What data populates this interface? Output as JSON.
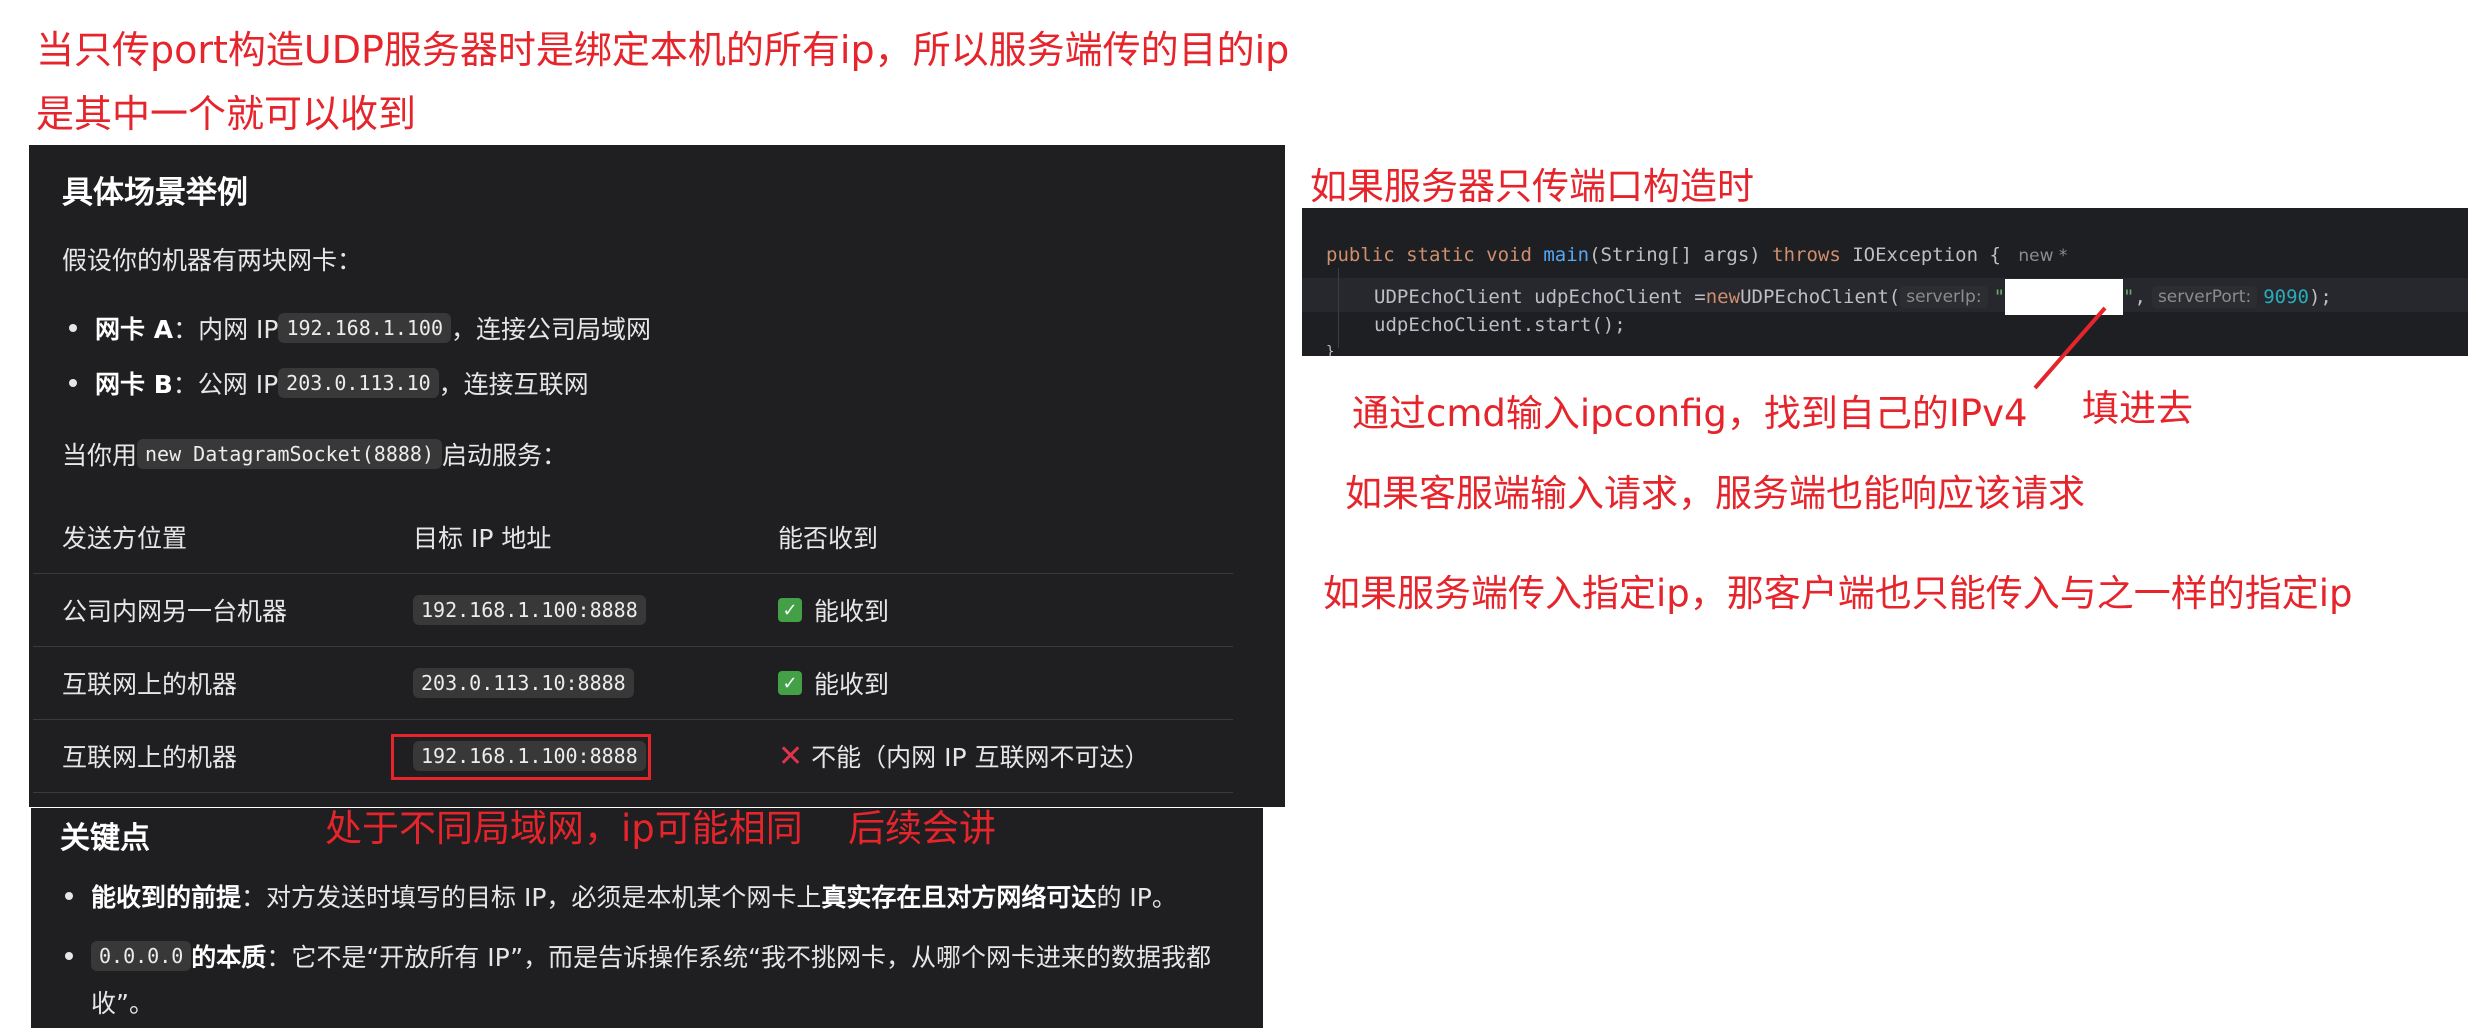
{
  "annotations": {
    "heading_note": "当只传port构造UDP服务器时是绑定本机的所有ip，所以服务端传的目的ip是其中一个就可以收到",
    "server_port_only": "如果服务器只传端口构造时",
    "cmd_ipconfig": "通过cmd输入ipconfig，找到自己的IPv4",
    "fill_in": "填进去",
    "client_request": "如果客服端输入请求，服务端也能响应该请求",
    "specified_ip": "如果服务端传入指定ip，那客户端也只能传入与之一样的指定ip",
    "different_lan": "处于不同局域网，ip可能相同",
    "later": "后续会讲"
  },
  "scenario": {
    "title": "具体场景举例",
    "intro": "假设你的机器有两块网卡：",
    "nic_a": {
      "label": "网卡 A",
      "pre": "：内网 IP ",
      "ip": "192.168.1.100",
      "post": "，连接公司局域网"
    },
    "nic_b": {
      "label": "网卡 B",
      "pre": "：公网 IP ",
      "ip": "203.0.113.10",
      "post": "，连接互联网"
    },
    "when_pre": "当你用 ",
    "when_code": "new DatagramSocket(8888)",
    "when_post": " 启动服务：",
    "table": {
      "headers": [
        "发送方位置",
        "目标 IP 地址",
        "能否收到"
      ],
      "rows": [
        {
          "sender": "公司内网另一台机器",
          "target": "192.168.1.100:8888",
          "result": "能收到",
          "ok": true
        },
        {
          "sender": "互联网上的机器",
          "target": "203.0.113.10:8888",
          "result": "能收到",
          "ok": true
        },
        {
          "sender": "互联网上的机器",
          "target": "192.168.1.100:8888",
          "result": "不能（内网 IP 互联网不可达）",
          "ok": false
        }
      ]
    }
  },
  "keypoints": {
    "title": "关键点",
    "b1_bold": "能收到的前提",
    "b1_mid": "：对方发送时填写的目标 IP，必须是本机某个网卡上",
    "b1_bold2": "真实存在且对方网络可达",
    "b1_end": "的 IP。",
    "b2_code": "0.0.0.0",
    "b2_bold": " 的本质",
    "b2_text1": "：它不是“开放所有 IP”，而是告诉操作系统“我不挑网卡，从哪个网卡进来的数据我都",
    "b2_text2": "收”。"
  },
  "code": {
    "l1_kw1": "public static void ",
    "l1_fn": "main",
    "l1_args": "(String[] args) ",
    "l1_kw2": "throws ",
    "l1_exc": "IOException {",
    "l1_hint": "new *",
    "l2_a": "UDPEchoClient udpEchoClient =",
    "l2_kw": "new ",
    "l2_b": "UDPEchoClient(",
    "l2_hint1": "serverIp:",
    "l2_q1": "\"",
    "l2_q2": "\"",
    "l2_comma": ",",
    "l2_hint2": "serverPort:",
    "l2_port": "9090",
    "l2_end": ");",
    "l3": "udpEchoClient.start();",
    "l4": "}"
  },
  "colors": {
    "annotation_red": "#e5242b",
    "panel_bg": "#1f1f21",
    "code_bg": "#1e1f22"
  }
}
